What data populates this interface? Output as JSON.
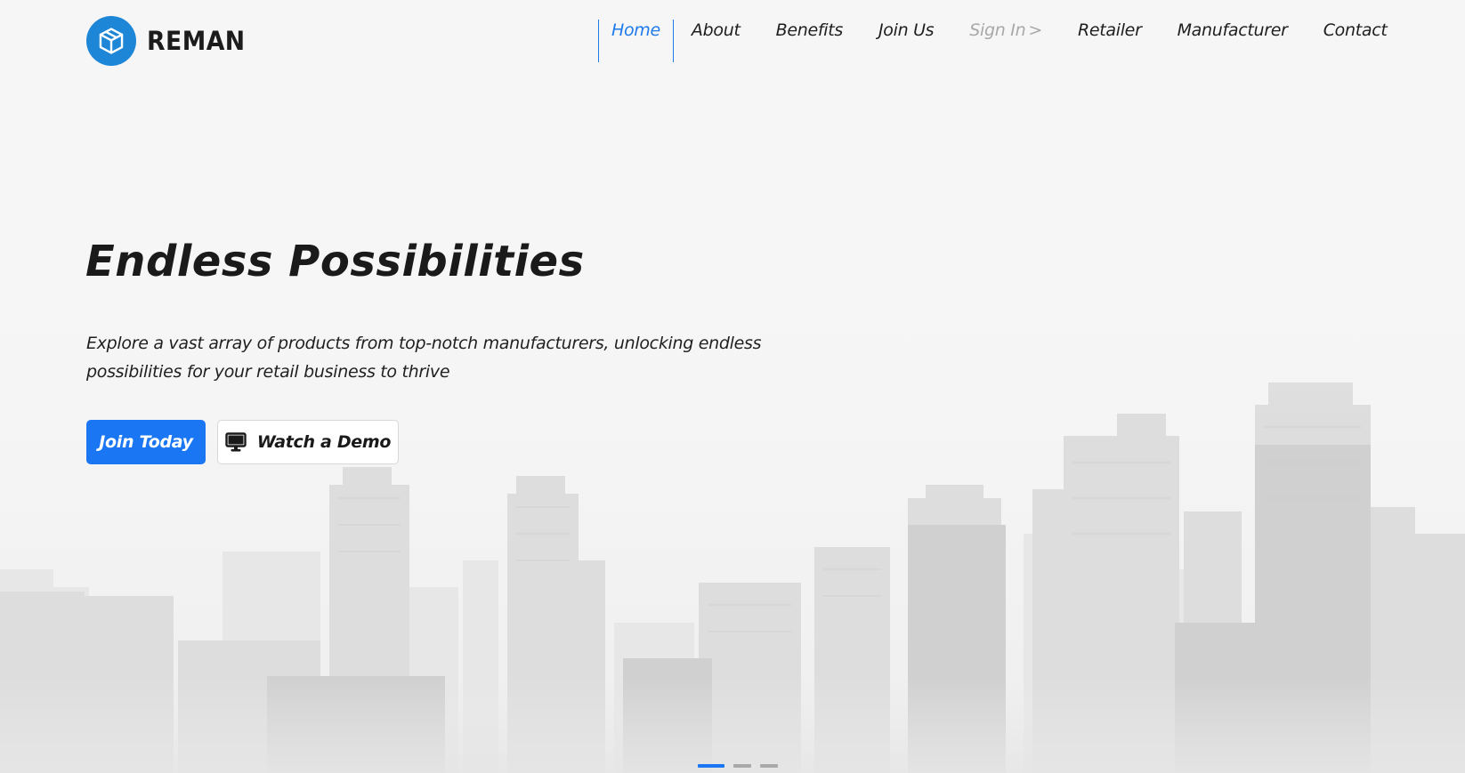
{
  "brand": {
    "name": "REMAN",
    "logo_icon": "cube-icon",
    "accent_color": "#1e86d6"
  },
  "nav": {
    "items": [
      {
        "label": "Home",
        "state": "active"
      },
      {
        "label": "About",
        "state": "normal"
      },
      {
        "label": "Benefits",
        "state": "normal"
      },
      {
        "label": "Join Us",
        "state": "normal"
      },
      {
        "label": "Sign In",
        "state": "muted",
        "icon": "chevron-right-icon"
      },
      {
        "label": "Retailer",
        "state": "normal"
      },
      {
        "label": "Manufacturer",
        "state": "normal"
      },
      {
        "label": "Contact",
        "state": "normal"
      }
    ],
    "active_color": "#1f7bea"
  },
  "hero": {
    "title": "Endless Possibilities",
    "subtitle": "Explore a vast array of products from top-notch manufacturers, unlocking endless possibilities for your retail business to thrive",
    "primary_button": "Join Today",
    "secondary_button": "Watch a Demo",
    "secondary_icon": "monitor-icon",
    "background": "city-skyline-image",
    "primary_color": "#1a76f2"
  },
  "carousel": {
    "slide_count": 3,
    "active_index": 0
  }
}
